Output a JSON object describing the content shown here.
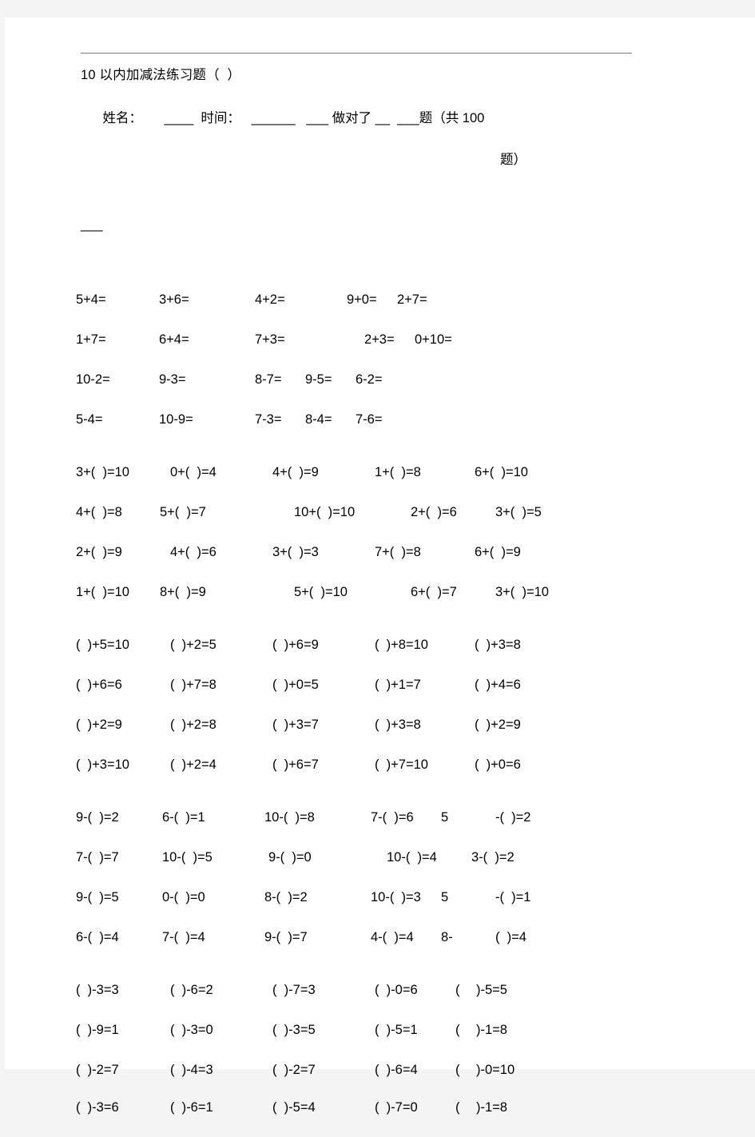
{
  "document": {
    "title": "10 以内加减法练习题（  ）",
    "info_main": "姓名：      ____  时间：   ______   ___ 做对了 __  ___题（共 100",
    "info_tail": "题）",
    "info_tail2": "___"
  },
  "blocks": [
    {
      "id": "block-1-basic-arithmetic",
      "rows": [
        {
          "cells": [
            "5+4=",
            "3+6=",
            "4+2=",
            "9+0=",
            "2+7="
          ]
        },
        {
          "cells": [
            "1+7=",
            "6+4=",
            "7+3=",
            "2+3=",
            "0+10="
          ]
        },
        {
          "cells": [
            "10-2=",
            "9-3=",
            "8-7=",
            "9-5=",
            "6-2="
          ]
        },
        {
          "cells": [
            "5-4=",
            "10-9=",
            "7-3=",
            "8-4=",
            "7-6="
          ]
        }
      ]
    },
    {
      "id": "block-2-missing-addend-right",
      "rows": [
        {
          "cells": [
            "3+(  )=10",
            "0+(  )=4",
            "4+(  )=9",
            "1+(  )=8",
            "6+(  )=10"
          ]
        },
        {
          "cells": [
            "4+(  )=8",
            "5+(  )=7",
            "10+(  )=10",
            "2+(  )=6",
            "3+(  )=5"
          ]
        },
        {
          "cells": [
            "2+(  )=9",
            "4+(  )=6",
            "3+(  )=3",
            "7+(  )=8",
            "6+(  )=9"
          ]
        },
        {
          "cells": [
            "1+(  )=10",
            "8+(  )=9",
            "5+(  )=10",
            "6+(  )=7",
            "3+(  )=10"
          ]
        }
      ]
    },
    {
      "id": "block-3-missing-addend-left",
      "rows": [
        {
          "cells": [
            "(  )+5=10",
            "(  )+2=5",
            "(  )+6=9",
            "(  )+8=10",
            "(  )+3=8"
          ]
        },
        {
          "cells": [
            "(  )+6=6",
            "(  )+7=8",
            "(  )+0=5",
            "(  )+1=7",
            "(  )+4=6"
          ]
        },
        {
          "cells": [
            "(  )+2=9",
            "(  )+2=8",
            "(  )+3=7",
            "(  )+3=8",
            "(  )+2=9"
          ]
        },
        {
          "cells": [
            "(  )+3=10",
            "(  )+2=4",
            "(  )+6=7",
            "(  )+7=10",
            "(  )+0=6"
          ]
        }
      ]
    },
    {
      "id": "block-4-missing-subtrahend",
      "rows": [
        {
          "cells": [
            "9-(  )=2",
            "6-(  )=1",
            "10-(  )=8",
            "7-(  )=6",
            "5",
            "-(  )=2"
          ]
        },
        {
          "cells": [
            "7-(  )=7",
            "10-(  )=5",
            "9-(  )=0",
            "10-(  )=4",
            "3-(  )=2"
          ]
        },
        {
          "cells": [
            "9-(  )=5",
            "0-(  )=0",
            "8-(  )=2",
            "10-(  )=3",
            "5",
            "-(  )=1"
          ]
        },
        {
          "cells": [
            "6-(  )=4",
            "7-(  )=4",
            "9-(  )=7",
            "4-(  )=4",
            "8-",
            "(  )=4"
          ]
        }
      ]
    },
    {
      "id": "block-5-missing-minuend",
      "rows": [
        {
          "cells": [
            "(  )-3=3",
            "(  )-6=2",
            "(  )-7=3",
            "(  )-0=6",
            "(",
            ")-5=5"
          ]
        },
        {
          "cells": [
            "(  )-9=1",
            "(  )-3=0",
            "(  )-3=5",
            "(  )-5=1",
            "(",
            ")-1=8"
          ]
        },
        {
          "cells": [
            "(  )-2=7",
            "(  )-4=3",
            "(  )-2=7",
            "(  )-6=4",
            "(",
            ")-0=10"
          ]
        },
        {
          "cells": [
            "(  )-3=6",
            "(  )-6=1",
            "(  )-5=4",
            "(  )-7=0",
            "(",
            ")-1=8"
          ]
        }
      ]
    }
  ]
}
